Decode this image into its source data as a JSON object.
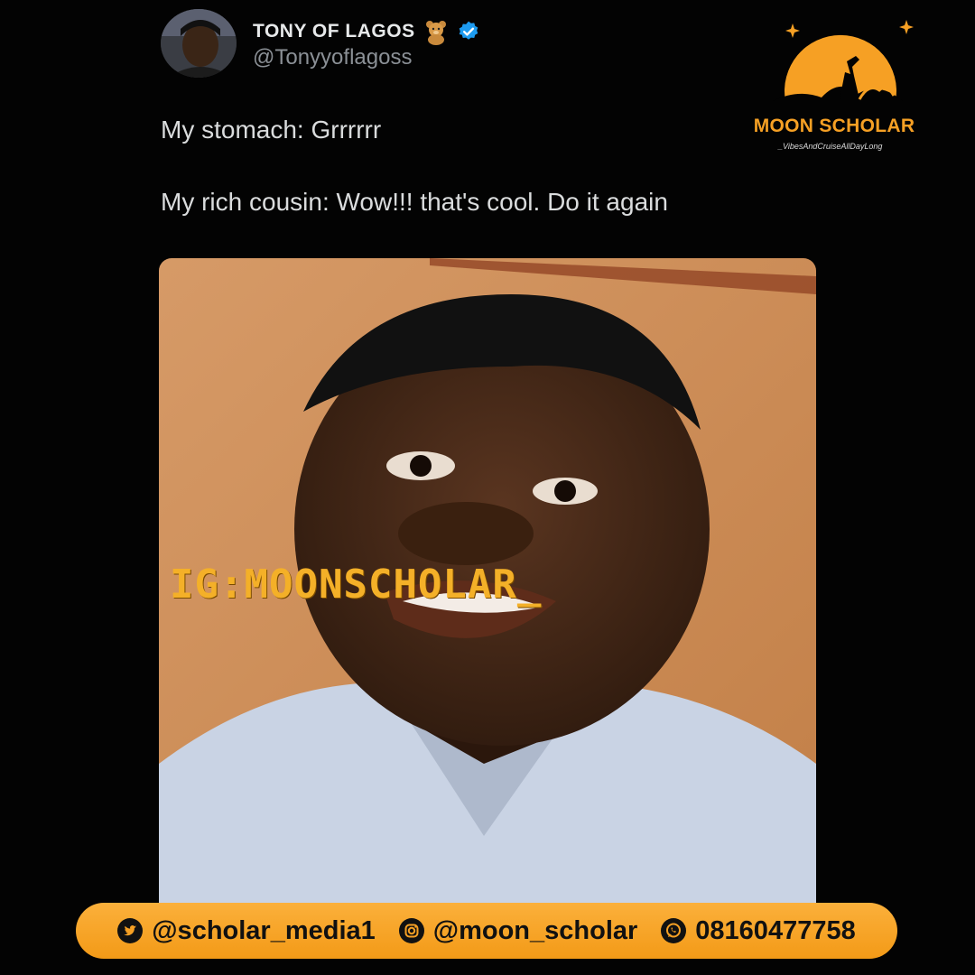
{
  "tweet": {
    "display_name": "TONY OF LAGOS",
    "handle": "@Tonyyoflagoss",
    "verified_icon": "verified-badge-icon",
    "lines": [
      "My stomach: Grrrrrr",
      "My rich cousin: Wow!!! that's cool. Do it again"
    ]
  },
  "logo": {
    "title": "MOON SCHOLAR",
    "tagline": "_VibesAndCruiseAllDayLong"
  },
  "image": {
    "watermark": "IG:MOONSCHOLAR_"
  },
  "footer": {
    "twitter": "@scholar_media1",
    "instagram": "@moon_scholar",
    "whatsapp": "08160477758"
  },
  "colors": {
    "accent": "#f6a024",
    "background": "#030303",
    "verified": "#1d9bf0"
  }
}
